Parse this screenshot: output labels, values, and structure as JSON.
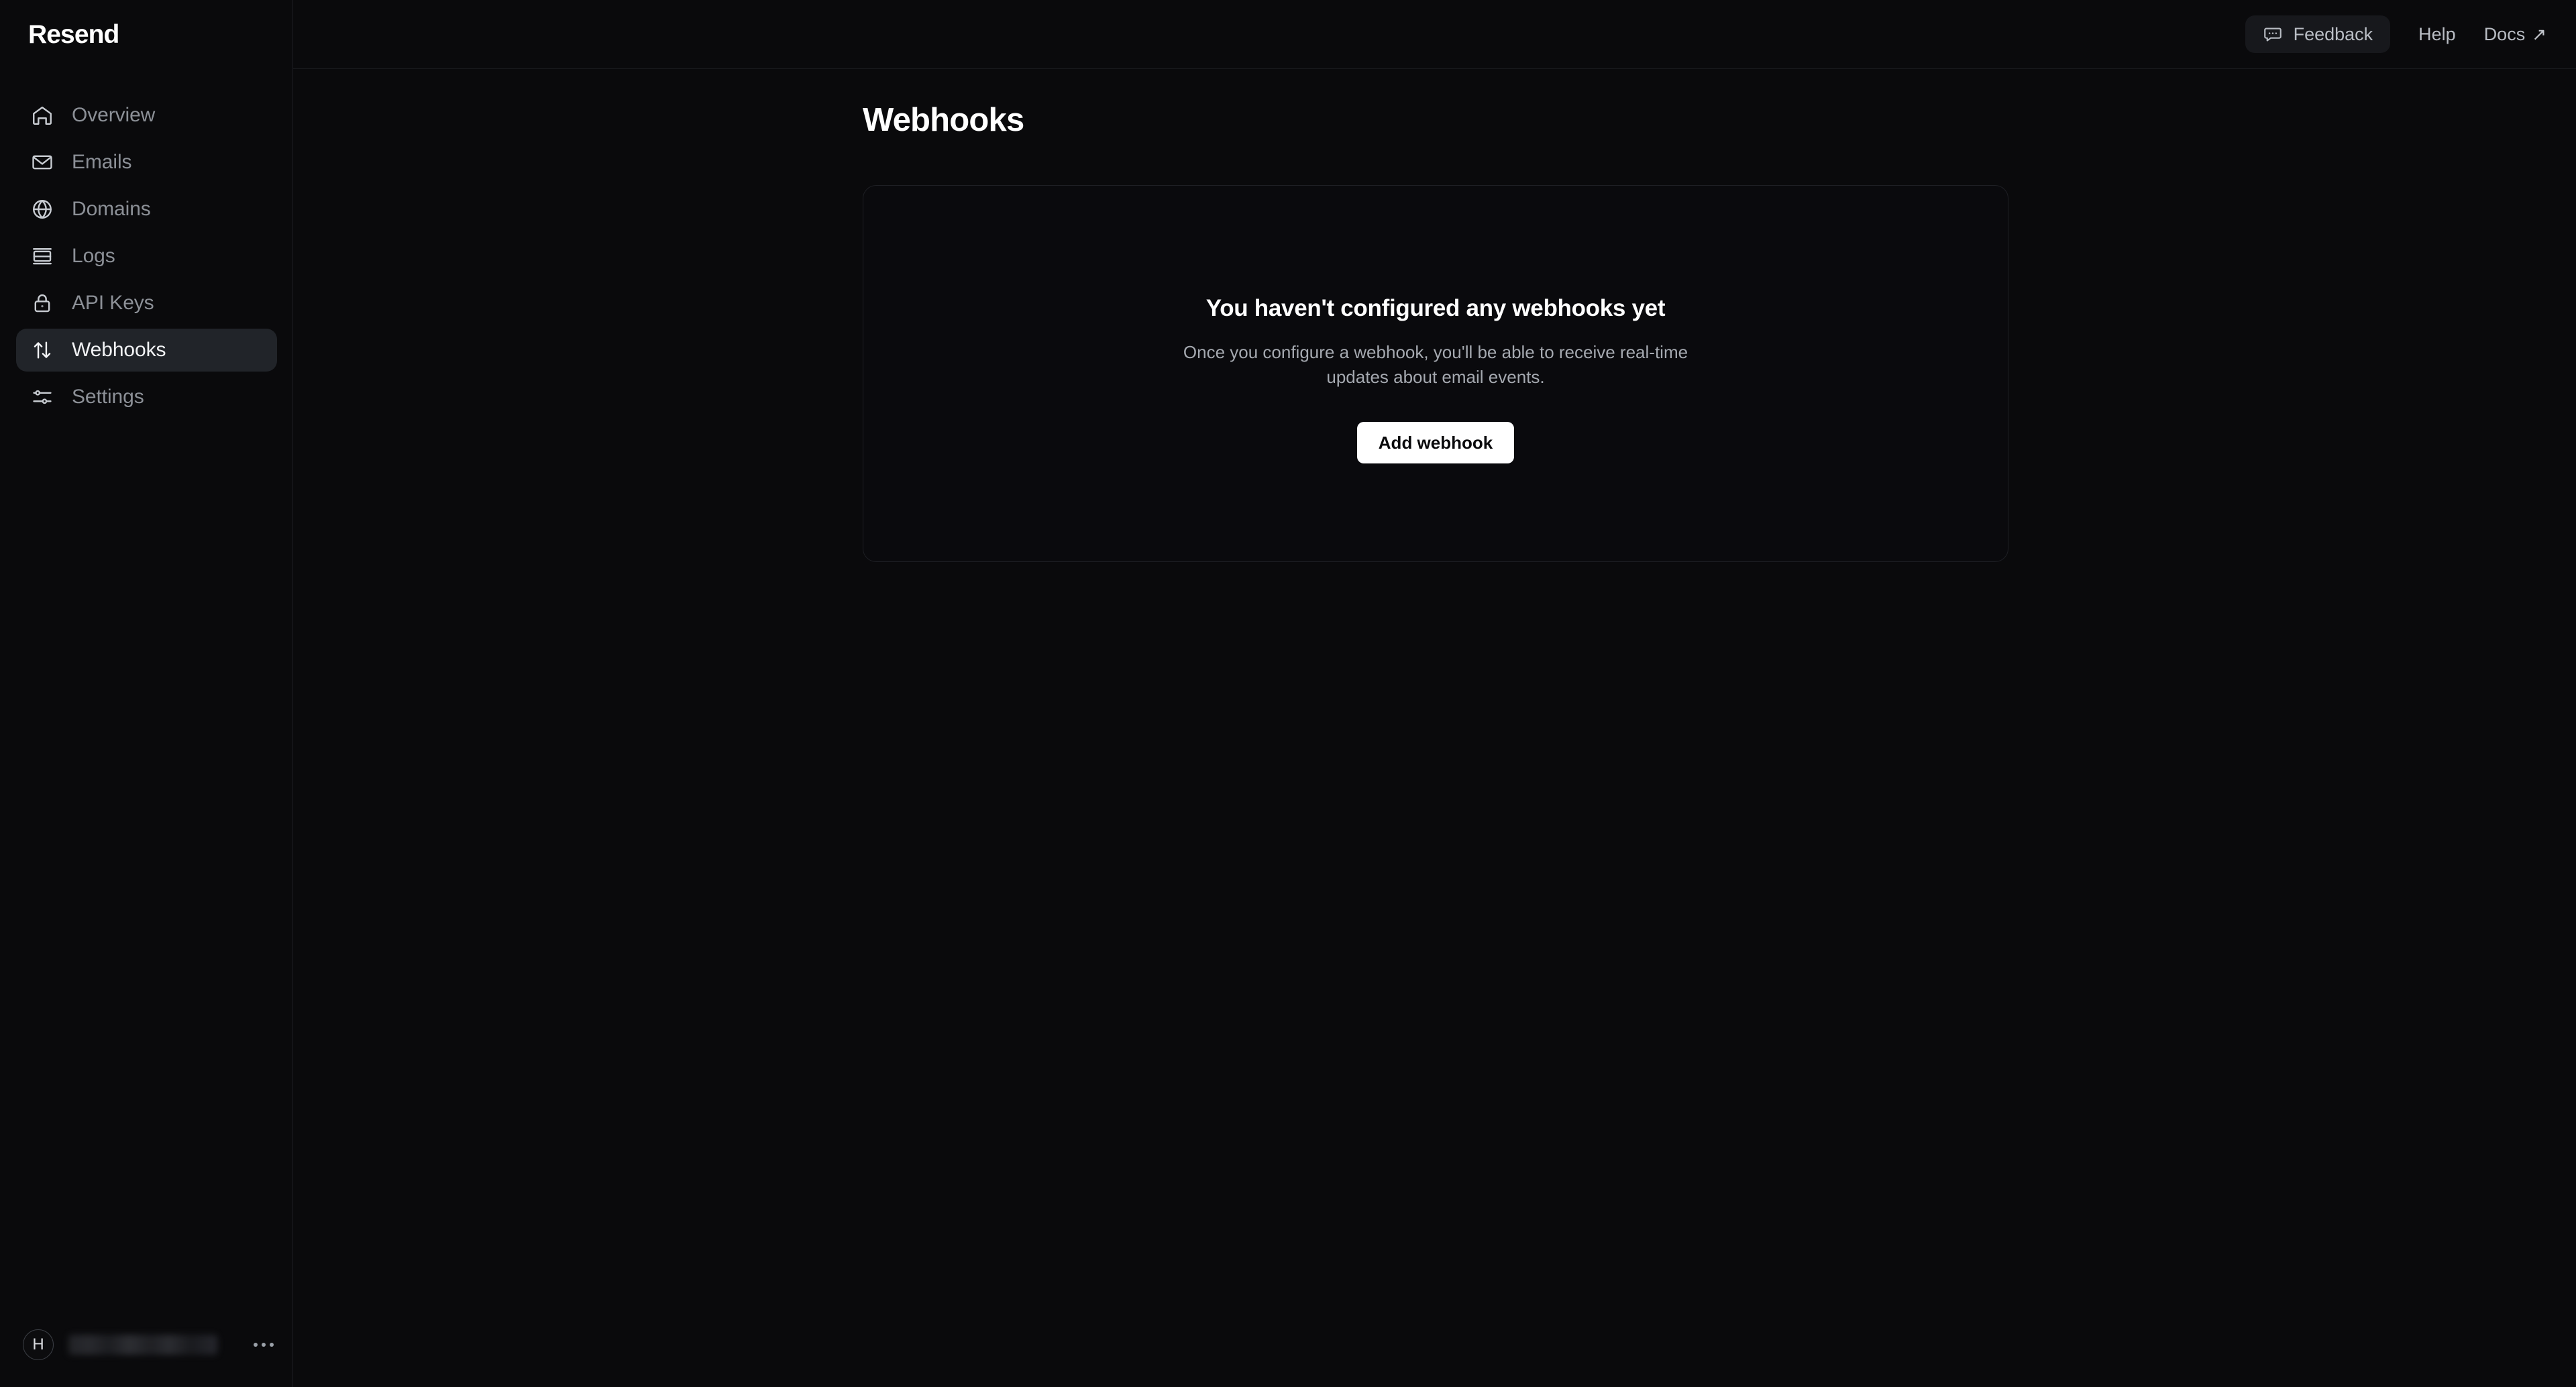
{
  "brand": {
    "name": "Resend"
  },
  "sidebar": {
    "items": [
      {
        "label": "Overview",
        "icon": "home-icon",
        "active": false
      },
      {
        "label": "Emails",
        "icon": "envelope-icon",
        "active": false
      },
      {
        "label": "Domains",
        "icon": "globe-icon",
        "active": false
      },
      {
        "label": "Logs",
        "icon": "logs-icon",
        "active": false
      },
      {
        "label": "API Keys",
        "icon": "lock-icon",
        "active": false
      },
      {
        "label": "Webhooks",
        "icon": "arrows-up-down-icon",
        "active": true
      },
      {
        "label": "Settings",
        "icon": "sliders-icon",
        "active": false
      }
    ],
    "user": {
      "avatar_initial": "H",
      "name_redacted": "",
      "menu_label": "..."
    }
  },
  "topbar": {
    "feedback_label": "Feedback",
    "help_label": "Help",
    "docs_label": "Docs",
    "docs_external_glyph": "↗"
  },
  "main": {
    "page_title": "Webhooks",
    "empty_state": {
      "title": "You haven't configured any webhooks yet",
      "description": "Once you configure a webhook, you'll be able to receive real-time updates about email events.",
      "cta_label": "Add webhook"
    }
  },
  "colors": {
    "background": "#0a0a0c",
    "surface": "#0a0a0d",
    "border": "#1e1f24",
    "active_nav_bg": "#212429",
    "text_primary": "#ffffff",
    "text_muted": "#8c9097",
    "cta_bg": "#ffffff",
    "cta_text": "#0a0a0c"
  }
}
